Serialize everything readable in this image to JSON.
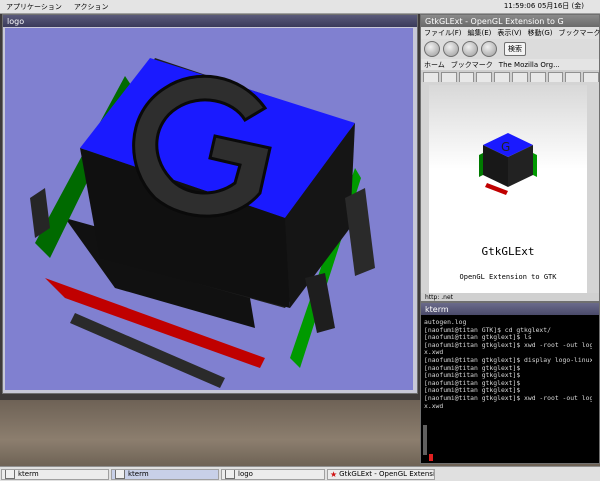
{
  "top_panel": {
    "menu_applications": "アプリケーション",
    "menu_actions": "アクション",
    "clock": "11:59:06 05月16日 (金)"
  },
  "logo_window": {
    "title": "logo"
  },
  "browser_window": {
    "title": "GtkGLExt - OpenGL Extension to G",
    "menu": [
      "ファイル(F)",
      "編集(E)",
      "表示(V)",
      "移動(G)",
      "ブックマーク"
    ],
    "search_label": "検索",
    "personal_bar": [
      "ホーム",
      "ブックマーク",
      "The Mozilla Org..."
    ],
    "page_title": "GtkGLExt",
    "page_subtitle": "OpenGL Extension to GTK",
    "status_text": "http: .net"
  },
  "kterm_window": {
    "title": "kterm",
    "lines": [
      {
        "text": "autogen.log",
        "color": "#d8d8d8"
      },
      {
        "text": "[naofumi@titan GTK]$ cd gtkglext/",
        "color": "#d8d8d8"
      },
      {
        "text": "[naofumi@titan gtkglext]$ ls",
        "color": "#d8d8d8"
      },
      {
        "text": "[naofumi@titan gtkglext]$ xwd -root -out logo-linu",
        "color": "#d8d8d8"
      },
      {
        "text": "x.xwd",
        "color": "#d8d8d8"
      },
      {
        "text": "[naofumi@titan gtkglext]$ display logo-linux.xwd",
        "color": "#d8d8d8"
      },
      {
        "text": "[naofumi@titan gtkglext]$",
        "color": "#d8d8d8"
      },
      {
        "text": "[naofumi@titan gtkglext]$",
        "color": "#d8d8d8"
      },
      {
        "text": "[naofumi@titan gtkglext]$",
        "color": "#d8d8d8"
      },
      {
        "text": "[naofumi@titan gtkglext]$",
        "color": "#d8d8d8"
      },
      {
        "text": "[naofumi@titan gtkglext]$ xwd -root -out logo-linu",
        "color": "#d8d8d8"
      },
      {
        "text": "x.xwd",
        "color": "#d8d8d8"
      }
    ]
  },
  "taskbar": {
    "tasks": [
      "kterm",
      "kterm",
      "logo",
      "GtkGLExt - OpenGL Extension to GTK"
    ]
  },
  "colors": {
    "gl_background": "#8080d0",
    "cube_blue": "#1a1aff",
    "cube_green": "#007a00",
    "cube_red": "#c00000",
    "letter_dark": "#2a2a2a"
  }
}
